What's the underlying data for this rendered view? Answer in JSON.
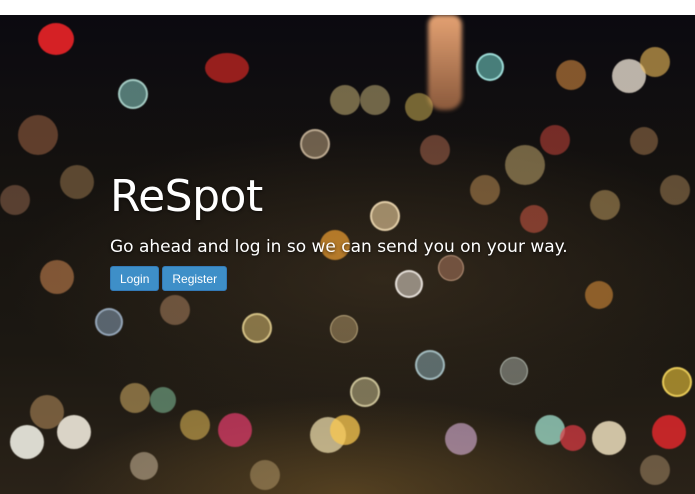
{
  "hero": {
    "title": "ReSpot",
    "tagline": "Go ahead and log in so we can send you on your way.",
    "buttons": {
      "login_label": "Login",
      "register_label": "Register"
    }
  },
  "colors": {
    "button_primary": "#3e8fc8",
    "title_text": "#ffffff"
  }
}
